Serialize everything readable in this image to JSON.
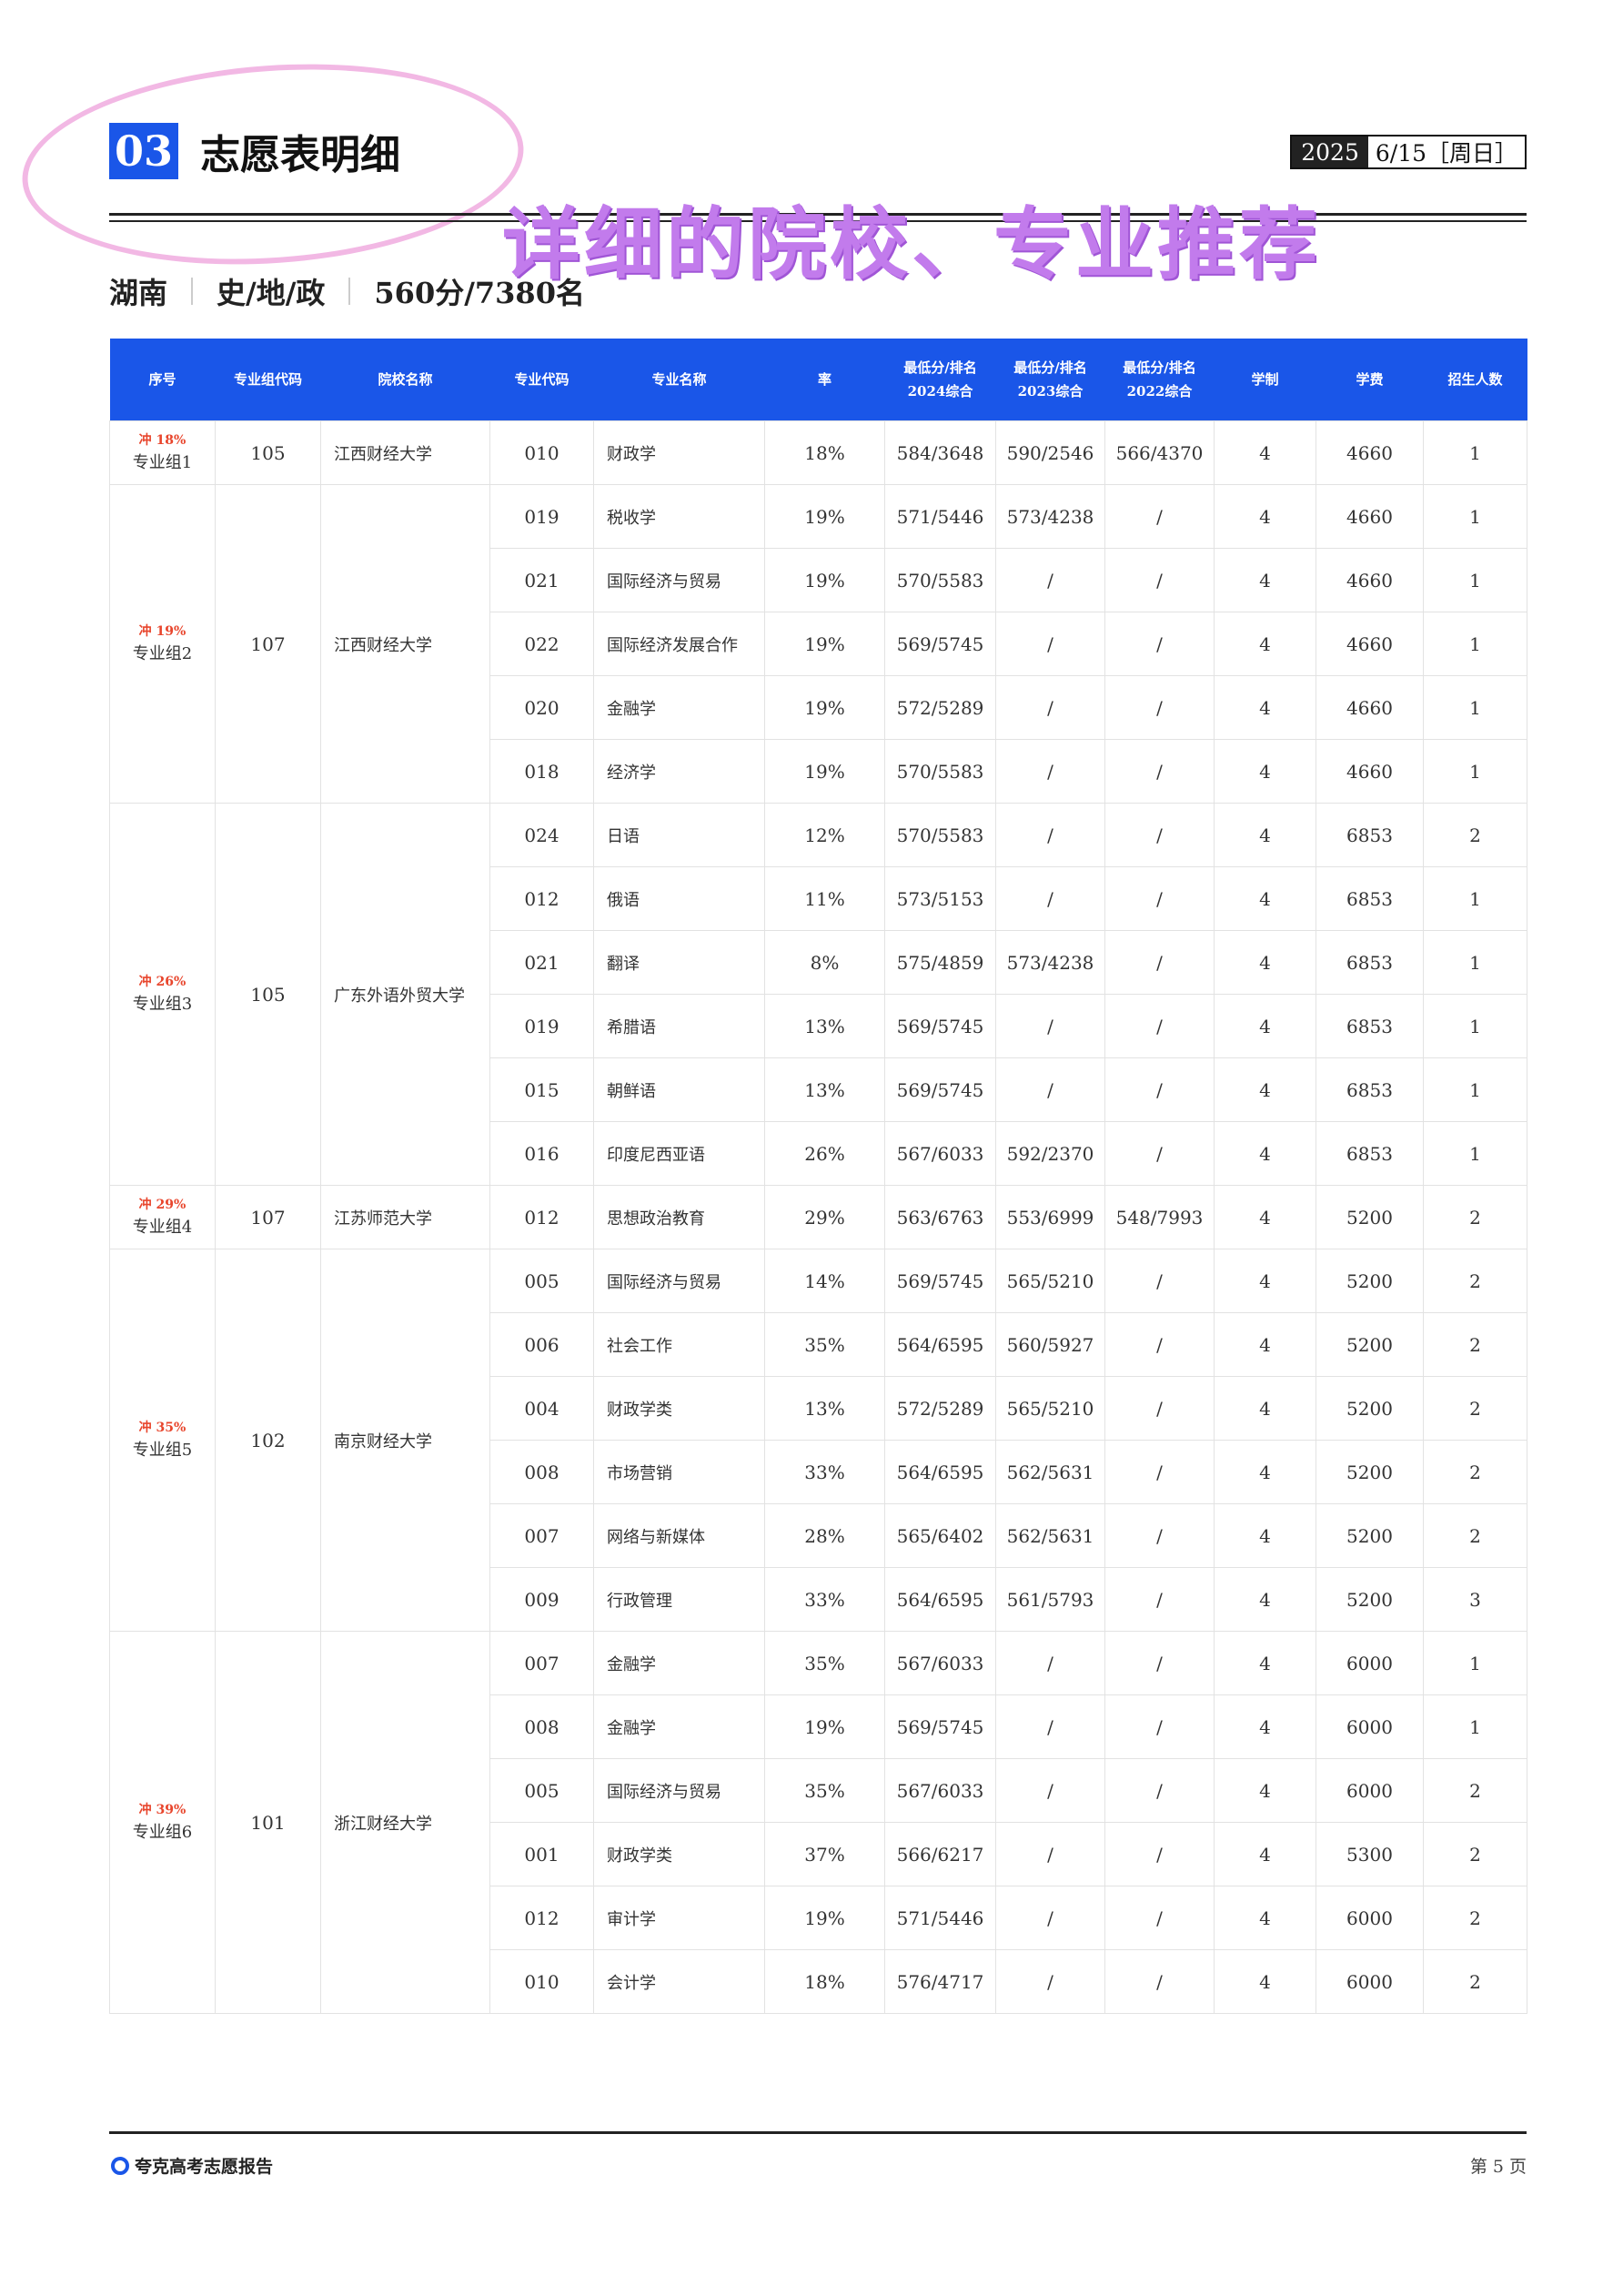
{
  "header": {
    "section_number": "03",
    "section_title": "志愿表明细",
    "date_year": "2025",
    "date_day": "6/15［周日］",
    "handwritten_note": "详细的院校、专业推荐"
  },
  "candidate": {
    "province": "湖南",
    "subjects": "史/地/政",
    "score_rank": "560分/7380名"
  },
  "table": {
    "headers": [
      "序号",
      "专业组代码",
      "院校名称",
      "专业代码",
      "专业名称",
      "率",
      "最低分/排名\n2024综合",
      "最低分/排名\n2023综合",
      "最低分/排名\n2022综合",
      "学制",
      "学费",
      "招生人数"
    ],
    "groups": [
      {
        "tag": "冲 18%",
        "name": "专业组1",
        "code": "105",
        "school": "江西财经大学",
        "rows": [
          [
            "010",
            "财政学",
            "18%",
            "584/3648",
            "590/2546",
            "566/4370",
            "4",
            "4660",
            "1"
          ]
        ]
      },
      {
        "tag": "冲 19%",
        "name": "专业组2",
        "code": "107",
        "school": "江西财经大学",
        "rows": [
          [
            "019",
            "税收学",
            "19%",
            "571/5446",
            "573/4238",
            "/",
            "4",
            "4660",
            "1"
          ],
          [
            "021",
            "国际经济与贸易",
            "19%",
            "570/5583",
            "/",
            "/",
            "4",
            "4660",
            "1"
          ],
          [
            "022",
            "国际经济发展合作",
            "19%",
            "569/5745",
            "/",
            "/",
            "4",
            "4660",
            "1"
          ],
          [
            "020",
            "金融学",
            "19%",
            "572/5289",
            "/",
            "/",
            "4",
            "4660",
            "1"
          ],
          [
            "018",
            "经济学",
            "19%",
            "570/5583",
            "/",
            "/",
            "4",
            "4660",
            "1"
          ]
        ]
      },
      {
        "tag": "冲 26%",
        "name": "专业组3",
        "code": "105",
        "school": "广东外语外贸大学",
        "rows": [
          [
            "024",
            "日语",
            "12%",
            "570/5583",
            "/",
            "/",
            "4",
            "6853",
            "2"
          ],
          [
            "012",
            "俄语",
            "11%",
            "573/5153",
            "/",
            "/",
            "4",
            "6853",
            "1"
          ],
          [
            "021",
            "翻译",
            "8%",
            "575/4859",
            "573/4238",
            "/",
            "4",
            "6853",
            "1"
          ],
          [
            "019",
            "希腊语",
            "13%",
            "569/5745",
            "/",
            "/",
            "4",
            "6853",
            "1"
          ],
          [
            "015",
            "朝鲜语",
            "13%",
            "569/5745",
            "/",
            "/",
            "4",
            "6853",
            "1"
          ],
          [
            "016",
            "印度尼西亚语",
            "26%",
            "567/6033",
            "592/2370",
            "/",
            "4",
            "6853",
            "1"
          ]
        ]
      },
      {
        "tag": "冲 29%",
        "name": "专业组4",
        "code": "107",
        "school": "江苏师范大学",
        "rows": [
          [
            "012",
            "思想政治教育",
            "29%",
            "563/6763",
            "553/6999",
            "548/7993",
            "4",
            "5200",
            "2"
          ]
        ]
      },
      {
        "tag": "冲 35%",
        "name": "专业组5",
        "code": "102",
        "school": "南京财经大学",
        "rows": [
          [
            "005",
            "国际经济与贸易",
            "14%",
            "569/5745",
            "565/5210",
            "/",
            "4",
            "5200",
            "2"
          ],
          [
            "006",
            "社会工作",
            "35%",
            "564/6595",
            "560/5927",
            "/",
            "4",
            "5200",
            "2"
          ],
          [
            "004",
            "财政学类",
            "13%",
            "572/5289",
            "565/5210",
            "/",
            "4",
            "5200",
            "2"
          ],
          [
            "008",
            "市场营销",
            "33%",
            "564/6595",
            "562/5631",
            "/",
            "4",
            "5200",
            "2"
          ],
          [
            "007",
            "网络与新媒体",
            "28%",
            "565/6402",
            "562/5631",
            "/",
            "4",
            "5200",
            "2"
          ],
          [
            "009",
            "行政管理",
            "33%",
            "564/6595",
            "561/5793",
            "/",
            "4",
            "5200",
            "3"
          ]
        ]
      },
      {
        "tag": "冲 39%",
        "name": "专业组6",
        "code": "101",
        "school": "浙江财经大学",
        "rows": [
          [
            "007",
            "金融学",
            "35%",
            "567/6033",
            "/",
            "/",
            "4",
            "6000",
            "1"
          ],
          [
            "008",
            "金融学",
            "19%",
            "569/5745",
            "/",
            "/",
            "4",
            "6000",
            "1"
          ],
          [
            "005",
            "国际经济与贸易",
            "35%",
            "567/6033",
            "/",
            "/",
            "4",
            "6000",
            "2"
          ],
          [
            "001",
            "财政学类",
            "37%",
            "566/6217",
            "/",
            "/",
            "4",
            "5300",
            "2"
          ],
          [
            "012",
            "审计学",
            "19%",
            "571/5446",
            "/",
            "/",
            "4",
            "6000",
            "2"
          ],
          [
            "010",
            "会计学",
            "18%",
            "576/4717",
            "/",
            "/",
            "4",
            "6000",
            "2"
          ]
        ]
      }
    ]
  },
  "footer": {
    "brand": "夸克高考志愿报告",
    "page": "第 5 页"
  },
  "colors": {
    "accent": "#1a56e8",
    "risk_tag": "#e8452c",
    "note": "#c27bec",
    "circle": "#f2b8e4"
  }
}
